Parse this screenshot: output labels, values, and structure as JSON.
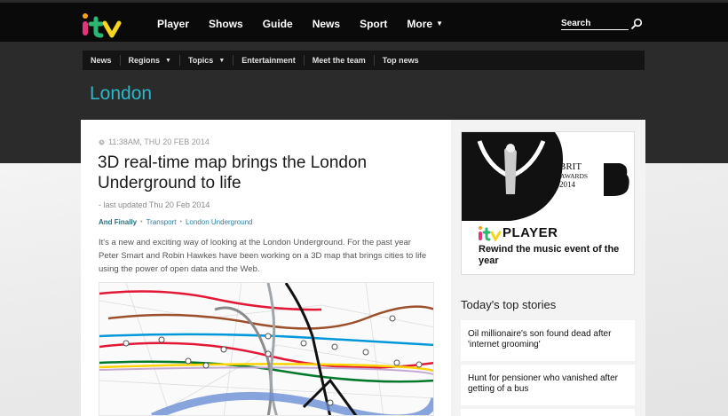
{
  "header": {
    "nav": [
      {
        "label": "Player",
        "caret": false
      },
      {
        "label": "Shows",
        "caret": false
      },
      {
        "label": "Guide",
        "caret": false
      },
      {
        "label": "News",
        "caret": false
      },
      {
        "label": "Sport",
        "caret": false
      },
      {
        "label": "More",
        "caret": true
      }
    ],
    "search_label": "Search"
  },
  "subnav": {
    "items": [
      "News",
      "Regions",
      "Topics",
      "Entertainment",
      "Meet the team",
      "Top news"
    ]
  },
  "region": {
    "title": "London"
  },
  "article": {
    "timestamp": "11:38AM, THU 20 FEB 2014",
    "headline": "3D real-time map brings the London Underground to life",
    "updated": "- last updated Thu 20 Feb 2014",
    "tag_main": "And Finally",
    "tags": [
      "Transport",
      "London Underground"
    ],
    "intro": "It's a new and exciting way of looking at the London Underground. For the past year Peter Smart and Robin Hawkes have been working on a 3D map that brings cities to life using the power of open data and the Web."
  },
  "sidebar": {
    "ad": {
      "brit": "BRIT",
      "awards": "AWARDS",
      "year": "2014",
      "player": "PLAYER",
      "tagline": "Rewind the music event of the year"
    },
    "top_stories_title": "Today's top stories",
    "stories": [
      "Oil millionaire's son found dead after 'internet grooming'",
      "Hunt for pensioner who vanished after getting of a bus"
    ]
  },
  "colors": {
    "accent": "#2ab8c9",
    "topbar": "#0a0a0a",
    "band": "#2b2b2b"
  }
}
